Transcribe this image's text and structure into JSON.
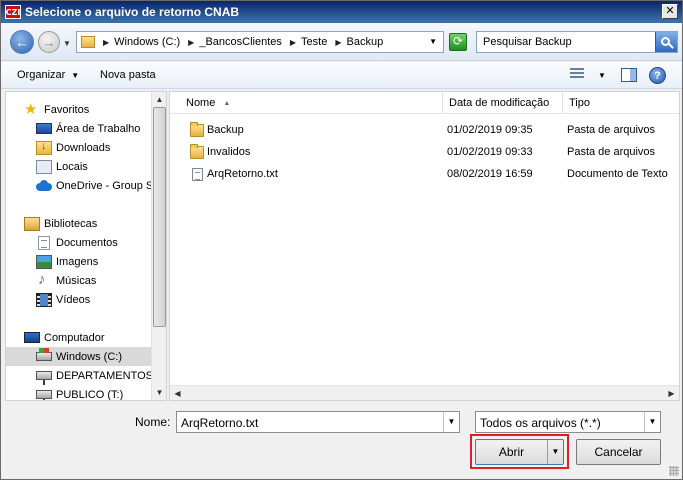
{
  "window": {
    "app_icon_text": "CZI",
    "title": "Selecione o arquivo de retorno CNAB",
    "close_label": "✕"
  },
  "address": {
    "crumbs": [
      "Windows (C:)",
      "_BancosClientes",
      "Teste",
      "Backup"
    ]
  },
  "search": {
    "placeholder": "Pesquisar Backup"
  },
  "toolbar": {
    "organize_label": "Organizar",
    "new_folder_label": "Nova pasta"
  },
  "nav": {
    "favorites": {
      "label": "Favoritos",
      "items": [
        "Área de Trabalho",
        "Downloads",
        "Locais",
        "OneDrive - Group So"
      ]
    },
    "libraries": {
      "label": "Bibliotecas",
      "items": [
        "Documentos",
        "Imagens",
        "Músicas",
        "Vídeos"
      ]
    },
    "computer": {
      "label": "Computador",
      "items": [
        "Windows (C:)",
        "DEPARTAMENTOS (S",
        "PUBLICO (T:)"
      ],
      "selected_index": 0
    }
  },
  "files": {
    "columns": [
      "Nome",
      "Data de modificação",
      "Tipo"
    ],
    "rows": [
      {
        "name": "Backup",
        "modified": "01/02/2019 09:35",
        "type": "Pasta de arquivos",
        "icon": "folder-icon"
      },
      {
        "name": "Invalidos",
        "modified": "01/02/2019 09:33",
        "type": "Pasta de arquivos",
        "icon": "folder-icon"
      },
      {
        "name": "ArqRetorno.txt",
        "modified": "08/02/2019 16:59",
        "type": "Documento de Texto",
        "icon": "text-file-icon"
      }
    ]
  },
  "bottom": {
    "name_label": "Nome:",
    "name_value": "ArqRetorno.txt",
    "filter_value": "Todos os arquivos (*.*)",
    "open_label": "Abrir",
    "cancel_label": "Cancelar"
  },
  "colors": {
    "highlight": "#e02020",
    "title_bar": "#0a246a"
  }
}
